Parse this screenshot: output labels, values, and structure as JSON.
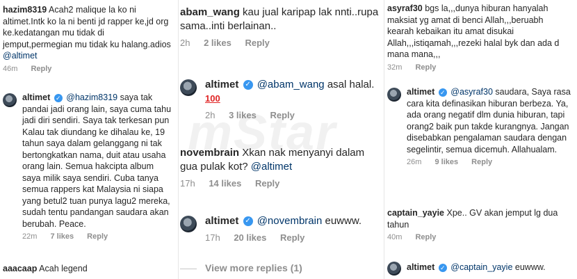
{
  "col1": {
    "c1": {
      "user": "hazim8319",
      "text": "Acah2 malique la ko ni altimet.Intk ko la ni benti jd rapper ke,jd org ke.kedatangan mu tidak di jemput,permegian mu tidak ku halang.adios",
      "mention": "@altimet",
      "time": "46m",
      "reply": "Reply"
    },
    "c2": {
      "user": "altimet",
      "mention": "@hazim8319",
      "text": "saya tak pandai jadi orang lain, saya cuma tahu jadi diri sendiri. Saya tak terkesan pun Kalau tak diundang ke dihalau ke, 19 tahun saya dalam gelanggang ni tak bertongkatkan nama, duit atau usaha orang lain. Semua hakcipta album saya milik saya sendiri. Cuba tanya semua rappers kat Malaysia ni siapa yang betul2 tuan punya lagu2 mereka, sudah tentu pandangan saudara akan berubah. Peace.",
      "time": "22m",
      "likes": "7 likes",
      "reply": "Reply"
    },
    "c3": {
      "user": "aaacaap",
      "text": "Acah legend"
    }
  },
  "col2": {
    "c1": {
      "user": "abam_wang",
      "text": "kau jual karipap lak nnti..rupa sama..inti berlainan..",
      "time": "2h",
      "likes": "2 likes",
      "reply": "Reply"
    },
    "c2": {
      "user": "altimet",
      "mention": "@abam_wang",
      "text": "asal halal.",
      "emoji": "100",
      "time": "2h",
      "likes": "3 likes",
      "reply": "Reply"
    },
    "c3": {
      "user": "novembrain",
      "text": "Xkan nak menyanyi dalam gua pulak kot?",
      "mention": "@altimet",
      "time": "17h",
      "likes": "14 likes",
      "reply": "Reply"
    },
    "c4": {
      "user": "altimet",
      "mention": "@novembrain",
      "text": "euwww.",
      "time": "17h",
      "likes": "20 likes",
      "reply": "Reply"
    },
    "view_more": "View more replies (1)"
  },
  "col3": {
    "c1": {
      "user": "asyraf30",
      "text": "bgs la,,,dunya hiburan hanyalah maksiat yg amat di benci Allah,,,beruabh kearah kebaikan itu amat disukai Allah,,,istiqamah,,,rezeki halal byk dan ada d mana mana,,,",
      "time": "32m",
      "reply": "Reply"
    },
    "c2": {
      "user": "altimet",
      "mention": "@asyraf30",
      "text": "saudara, Saya rasa cara kita definasikan hiburan berbeza. Ya, ada orang negatif dlm dunia hiburan, tapi orang2 baik pun takde kurangnya. Jangan disebabkan pengalaman saudara dengan segelintir, semua dicemuh. Allahualam.",
      "time": "26m",
      "likes": "9 likes",
      "reply": "Reply"
    },
    "c3": {
      "user": "captain_yayie",
      "text": "Xpe.. GV akan jemput lg dua tahun",
      "time": "40m",
      "reply": "Reply"
    },
    "c4": {
      "user": "altimet",
      "mention": "@captain_yayie",
      "text": "euwww."
    }
  },
  "watermark": "mStar",
  "colors": {
    "mention": "#003569",
    "verified": "#3897f0",
    "meta": "#8e8e8e"
  }
}
